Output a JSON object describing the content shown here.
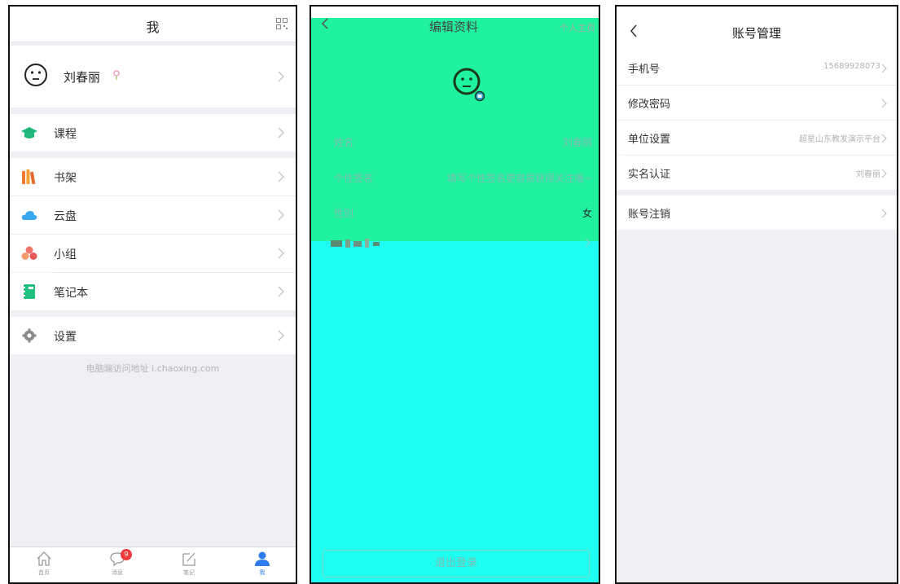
{
  "screen1": {
    "title": "我",
    "profile_name": "刘春丽",
    "menu": [
      {
        "label": "课程",
        "icon": "graduation-cap-icon",
        "color": "#1fb67a"
      },
      {
        "label": "书架",
        "icon": "bookshelf-icon",
        "color": "#f07a30"
      },
      {
        "label": "云盘",
        "icon": "cloud-icon",
        "color": "#3aa8f0"
      },
      {
        "label": "小组",
        "icon": "group-icon",
        "color": "#f0736a"
      },
      {
        "label": "笔记本",
        "icon": "notebook-icon",
        "color": "#20c080"
      },
      {
        "label": "设置",
        "icon": "gear-icon",
        "color": "#8a8a8a"
      }
    ],
    "pc_tip": "电脑端访问地址 i.chaoxing.com",
    "tabs": [
      {
        "label": "首页",
        "icon": "home-icon"
      },
      {
        "label": "消息",
        "icon": "message-icon",
        "badge": "9"
      },
      {
        "label": "笔记",
        "icon": "note-edit-icon"
      },
      {
        "label": "我",
        "icon": "person-icon",
        "active": true
      }
    ]
  },
  "screen2": {
    "title": "编辑资料",
    "homepage_link": "个人主页",
    "fields": [
      {
        "label": "姓名",
        "value": "刘春丽"
      },
      {
        "label": "个性签名",
        "value": "填写个性签名更容易获得关注哦~"
      },
      {
        "label": "性别",
        "value": "女"
      }
    ],
    "logout_label": "退出登录"
  },
  "screen3": {
    "title": "账号管理",
    "rows": [
      {
        "label": "手机号",
        "value": "15689928073"
      },
      {
        "label": "修改密码",
        "value": ""
      },
      {
        "label": "单位设置",
        "value": "超星山东教发演示平台"
      },
      {
        "label": "实名认证",
        "value": "刘春丽"
      }
    ],
    "cancel_label": "账号注销"
  },
  "colors": {
    "accent_blue": "#2f7bf0",
    "badge_red": "#f03c3c",
    "edit_bg_green": "#1ff3a0",
    "edit_bg_cyan": "#1efff2"
  }
}
